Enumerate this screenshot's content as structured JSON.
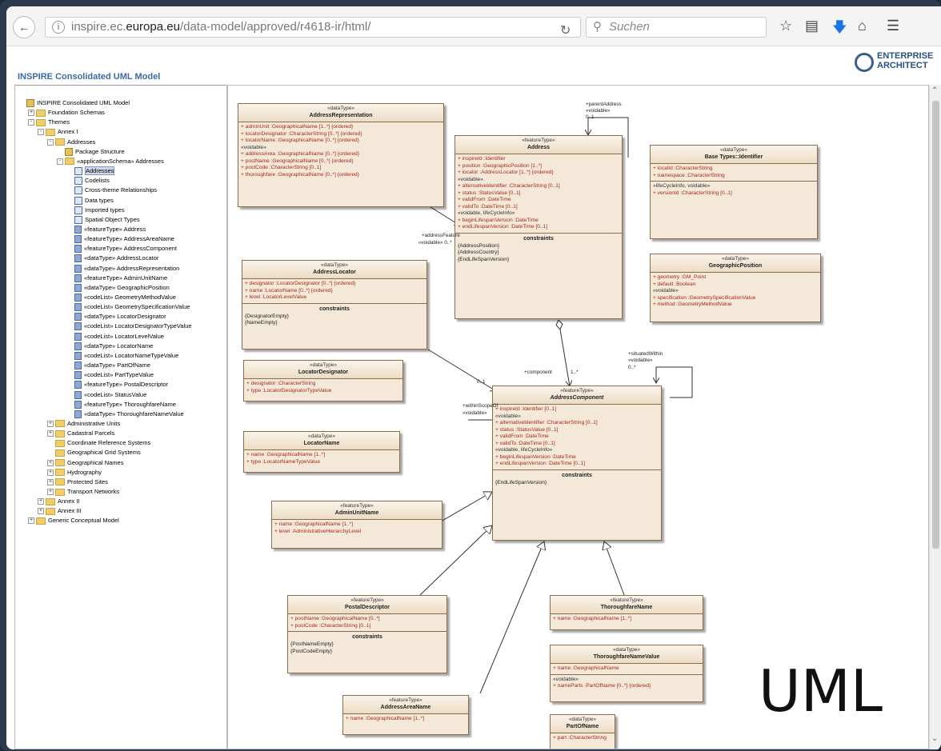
{
  "browser": {
    "url_host_pre": "inspire.ec.",
    "url_host_bold": "europa.eu",
    "url_path": "/data-model/approved/r4618-ir/html/",
    "search_placeholder": "Suchen"
  },
  "brand": {
    "line1": "ENTERPRISE",
    "line2": "ARCHITECT"
  },
  "page_title": "INSPIRE Consolidated UML Model",
  "tree": [
    {
      "label": "INSPIRE Consolidated UML Model",
      "depth": 0,
      "icon": "pk",
      "ex": ""
    },
    {
      "label": "Foundation Schemas",
      "depth": 1,
      "icon": "fd",
      "ex": "+"
    },
    {
      "label": "Themes",
      "depth": 1,
      "icon": "fd",
      "ex": "-"
    },
    {
      "label": "Annex I",
      "depth": 2,
      "icon": "fd",
      "ex": "-"
    },
    {
      "label": "Addresses",
      "depth": 3,
      "icon": "fd",
      "ex": "-"
    },
    {
      "label": "Package Structure",
      "depth": 4,
      "icon": "pk",
      "ex": ""
    },
    {
      "label": "«applicationSchema» Addresses",
      "depth": 4,
      "icon": "fd",
      "ex": "-"
    },
    {
      "label": "Addresses",
      "depth": 5,
      "icon": "dg",
      "ex": "",
      "selected": true
    },
    {
      "label": "Codelists",
      "depth": 5,
      "icon": "dg",
      "ex": ""
    },
    {
      "label": "Cross-theme Relationships",
      "depth": 5,
      "icon": "dg",
      "ex": ""
    },
    {
      "label": "Data types",
      "depth": 5,
      "icon": "dg",
      "ex": ""
    },
    {
      "label": "Imported types",
      "depth": 5,
      "icon": "dg",
      "ex": ""
    },
    {
      "label": "Spatial Object Types",
      "depth": 5,
      "icon": "dg",
      "ex": ""
    },
    {
      "label": "«featureType» Address",
      "depth": 5,
      "icon": "cl",
      "ex": ""
    },
    {
      "label": "«featureType» AddressAreaName",
      "depth": 5,
      "icon": "cl",
      "ex": ""
    },
    {
      "label": "«featureType» AddressComponent",
      "depth": 5,
      "icon": "cl",
      "ex": ""
    },
    {
      "label": "«dataType» AddressLocator",
      "depth": 5,
      "icon": "cl",
      "ex": ""
    },
    {
      "label": "«dataType» AddressRepresentation",
      "depth": 5,
      "icon": "cl",
      "ex": ""
    },
    {
      "label": "«featureType» AdminUnitName",
      "depth": 5,
      "icon": "cl",
      "ex": ""
    },
    {
      "label": "«dataType» GeographicPosition",
      "depth": 5,
      "icon": "cl",
      "ex": ""
    },
    {
      "label": "«codeList» GeometryMethodValue",
      "depth": 5,
      "icon": "cl",
      "ex": ""
    },
    {
      "label": "«codeList» GeometrySpecificationValue",
      "depth": 5,
      "icon": "cl",
      "ex": ""
    },
    {
      "label": "«dataType» LocatorDesignator",
      "depth": 5,
      "icon": "cl",
      "ex": ""
    },
    {
      "label": "«codeList» LocatorDesignatorTypeValue",
      "depth": 5,
      "icon": "cl",
      "ex": ""
    },
    {
      "label": "«codeList» LocatorLevelValue",
      "depth": 5,
      "icon": "cl",
      "ex": ""
    },
    {
      "label": "«dataType» LocatorName",
      "depth": 5,
      "icon": "cl",
      "ex": ""
    },
    {
      "label": "«codeList» LocatorNameTypeValue",
      "depth": 5,
      "icon": "cl",
      "ex": ""
    },
    {
      "label": "«dataType» PartOfName",
      "depth": 5,
      "icon": "cl",
      "ex": ""
    },
    {
      "label": "«codeList» PartTypeValue",
      "depth": 5,
      "icon": "cl",
      "ex": ""
    },
    {
      "label": "«featureType» PostalDescriptor",
      "depth": 5,
      "icon": "cl",
      "ex": ""
    },
    {
      "label": "«codeList» StatusValue",
      "depth": 5,
      "icon": "cl",
      "ex": ""
    },
    {
      "label": "«featureType» ThoroughfareName",
      "depth": 5,
      "icon": "cl",
      "ex": ""
    },
    {
      "label": "«dataType» ThoroughfareNameValue",
      "depth": 5,
      "icon": "cl",
      "ex": ""
    },
    {
      "label": "Administrative Units",
      "depth": 3,
      "icon": "fd",
      "ex": "+"
    },
    {
      "label": "Cadastral Parcels",
      "depth": 3,
      "icon": "fd",
      "ex": "+"
    },
    {
      "label": "Coordinate Reference Systems",
      "depth": 3,
      "icon": "fd",
      "ex": ""
    },
    {
      "label": "Geographical Grid Systems",
      "depth": 3,
      "icon": "fd",
      "ex": ""
    },
    {
      "label": "Geographical Names",
      "depth": 3,
      "icon": "fd",
      "ex": "+"
    },
    {
      "label": "Hydrography",
      "depth": 3,
      "icon": "fd",
      "ex": "+"
    },
    {
      "label": "Protected Sites",
      "depth": 3,
      "icon": "fd",
      "ex": "+"
    },
    {
      "label": "Transport Networks",
      "depth": 3,
      "icon": "fd",
      "ex": "+"
    },
    {
      "label": "Annex II",
      "depth": 2,
      "icon": "fd",
      "ex": "+"
    },
    {
      "label": "Annex III",
      "depth": 2,
      "icon": "fd",
      "ex": "+"
    },
    {
      "label": "Generic Conceptual Model",
      "depth": 1,
      "icon": "fd",
      "ex": "+"
    }
  ],
  "classes": {
    "addrRep": {
      "st": "«dataType»",
      "nm": "AddressRepresentation",
      "a1": "+  adminUnit  :GeographicalName [1..*] {ordered}",
      "a2": "+  locatorDesignator  :CharacterString [0..*] {ordered}",
      "a3": "+  locatorName  :GeographicalName [0..*] {ordered}",
      "k": "«voidable»",
      "a4": "+  addressArea  :GeographicalName [0..*] {ordered}",
      "a5": "+  postName  :GeographicalName [0..*] {ordered}",
      "a6": "+  postCode  :CharacterString [0..1]",
      "a7": "+  thoroughfare  :GeographicalName [0..*] {ordered}"
    },
    "address": {
      "st": "«featureType»",
      "nm": "Address",
      "a1": "+  inspireId  :Identifier",
      "a2": "+  position  :GeographicPosition [1..*]",
      "a3": "+  locator  :AddressLocator [1..*] {ordered}",
      "k1": "«voidable»",
      "a4": "+  alternativeIdentifier  :CharacterString [0..1]",
      "a5": "+  status  :StatusValue [0..1]",
      "a6": "+  validFrom  :DateTime",
      "a7": "+  validTo  :DateTime [0..1]",
      "k2": "«voidable, lifeCycleInfo»",
      "a8": "+  beginLifespanVersion  :DateTime",
      "a9": "+  endLifespanVersion  :DateTime [0..1]",
      "ct": "constraints",
      "c1": "{AddressPosition}",
      "c2": "{AddressCountry}",
      "c3": "{EndLifeSpanVersion}"
    },
    "baseId": {
      "st": "«dataType»",
      "nm": "Base Types::Identifier",
      "a1": "+  localId  :CharacterString",
      "a2": "+  namespace  :CharacterString",
      "k": "«lifeCycleInfo, voidable»",
      "a3": "+  versionId  :CharacterString [0..1]"
    },
    "geoPos": {
      "st": "«dataType»",
      "nm": "GeographicPosition",
      "a1": "+  geometry  :GM_Point",
      "a2": "+  default  :Boolean",
      "k": "«voidable»",
      "a3": "+  specification  :GeometrySpecificationValue",
      "a4": "+  method  :GeometryMethodValue"
    },
    "addrLoc": {
      "st": "«dataType»",
      "nm": "AddressLocator",
      "a1": "+  designator  :LocatorDesignator [0..*] {ordered}",
      "a2": "+  name  :LocatorName [0..*] {ordered}",
      "a3": "+  level  :LocatorLevelValue",
      "ct": "constraints",
      "c1": "{DesignatorEmpty}",
      "c2": "{NameEmpty}"
    },
    "locDes": {
      "st": "«dataType»",
      "nm": "LocatorDesignator",
      "a1": "+  designator  :CharacterString",
      "a2": "+  type  :LocatorDesignatorTypeValue"
    },
    "locName": {
      "st": "«dataType»",
      "nm": "LocatorName",
      "a1": "+  name  :GeographicalName [1..*]",
      "a2": "+  type  :LocatorNameTypeValue"
    },
    "addrComp": {
      "st": "«featureType»",
      "nm": "AddressComponent",
      "a1": "+  inspireId  :Identifier [0..1]",
      "k1": "«voidable»",
      "a2": "+  alternativeIdentifier  :CharacterString [0..1]",
      "a3": "+  status  :StatusValue [0..1]",
      "a4": "+  validFrom  :DateTime",
      "a5": "+  validTo  :DateTime [0..1]",
      "k2": "«voidable, lifeCycleInfo»",
      "a6": "+  beginLifespanVersion  :DateTime",
      "a7": "+  endLifespanVersion  :DateTime [0..1]",
      "ct": "constraints",
      "c1": "{EndLifeSpanVersion}"
    },
    "adminUnit": {
      "st": "«featureType»",
      "nm": "AdminUnitName",
      "a1": "+  name  :GeographicalName [1..*]",
      "a2": "+  level  :AdministrativeHierarchyLevel"
    },
    "postal": {
      "st": "«featureType»",
      "nm": "PostalDescriptor",
      "a1": "+  postName  :GeographicalName [0..*]",
      "a2": "+  postCode  :CharacterString [0..1]",
      "ct": "constraints",
      "c1": "{PostNameEmpty}",
      "c2": "{PostCodeEmpty}"
    },
    "thorName": {
      "st": "«featureType»",
      "nm": "ThoroughfareName",
      "a1": "+  name  :GeographicalName [1..*]"
    },
    "thorVal": {
      "st": "«dataType»",
      "nm": "ThoroughfareNameValue",
      "a1": "+  name  :GeographicalName",
      "k": "«voidable»",
      "a2": "+  nameParts  :PartOfName [0..*] {ordered}"
    },
    "areaName": {
      "st": "«featureType»",
      "nm": "AddressAreaName",
      "a1": "+  name  :GeographicalName [1..*]"
    },
    "partOf": {
      "st": "«dataType»",
      "nm": "PartOfName",
      "a1": "+  part  :CharacterString"
    }
  },
  "labels": {
    "parentAddress": "+parentAddress",
    "voidable1": "«voidable»",
    "mult01a": "0..1",
    "addressFeature": "+addressFeature",
    "voidable01": "«voidable» 0..*",
    "component": "+component",
    "mult1n": "1..*",
    "mult01b": "0..1",
    "situatedWithin": "+situatedWithin",
    "voidable2": "«voidable»",
    "mult0n": "0..*",
    "withinScopeOf": "+withinScopeOf",
    "voidable3": "«voidable»"
  },
  "overlay_text": "UML"
}
